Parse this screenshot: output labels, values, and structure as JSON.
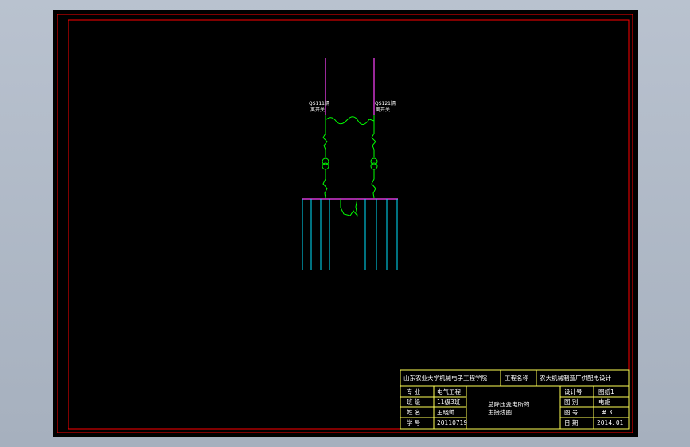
{
  "diagram": {
    "switch_left_label": "QS111隔",
    "switch_left_label2": "离开关",
    "switch_right_label": "QS121隔",
    "switch_right_label2": "离开关"
  },
  "title_block": {
    "school": "山东农业大学机械电子工程学院",
    "project_name_label": "工程名称",
    "project_name": "农大机械制造厂供配电设计",
    "major_label": "专  业",
    "major": "电气工程",
    "class_label": "班  级",
    "class": "11级3班",
    "name_label": "姓  名",
    "name": "王晓帅",
    "student_no_label": "学  号",
    "student_no": "20110719",
    "drawing_title_1": "总降压变电所的",
    "drawing_title_2": "主接线图",
    "designer_label": "设计号",
    "designer": "图纸1",
    "drafter_label": "图  别",
    "drafter": "电施",
    "sheet_no_label": "图  号",
    "sheet_no": "# 3",
    "date_label": "日  期",
    "date": "2014. 01"
  },
  "colors": {
    "frame": "#ff0000",
    "title_block": "#ffff55",
    "bus": "#ff44ff",
    "feeder": "#00e5ff",
    "equipment": "#00ff00",
    "text": "#ffffff"
  }
}
